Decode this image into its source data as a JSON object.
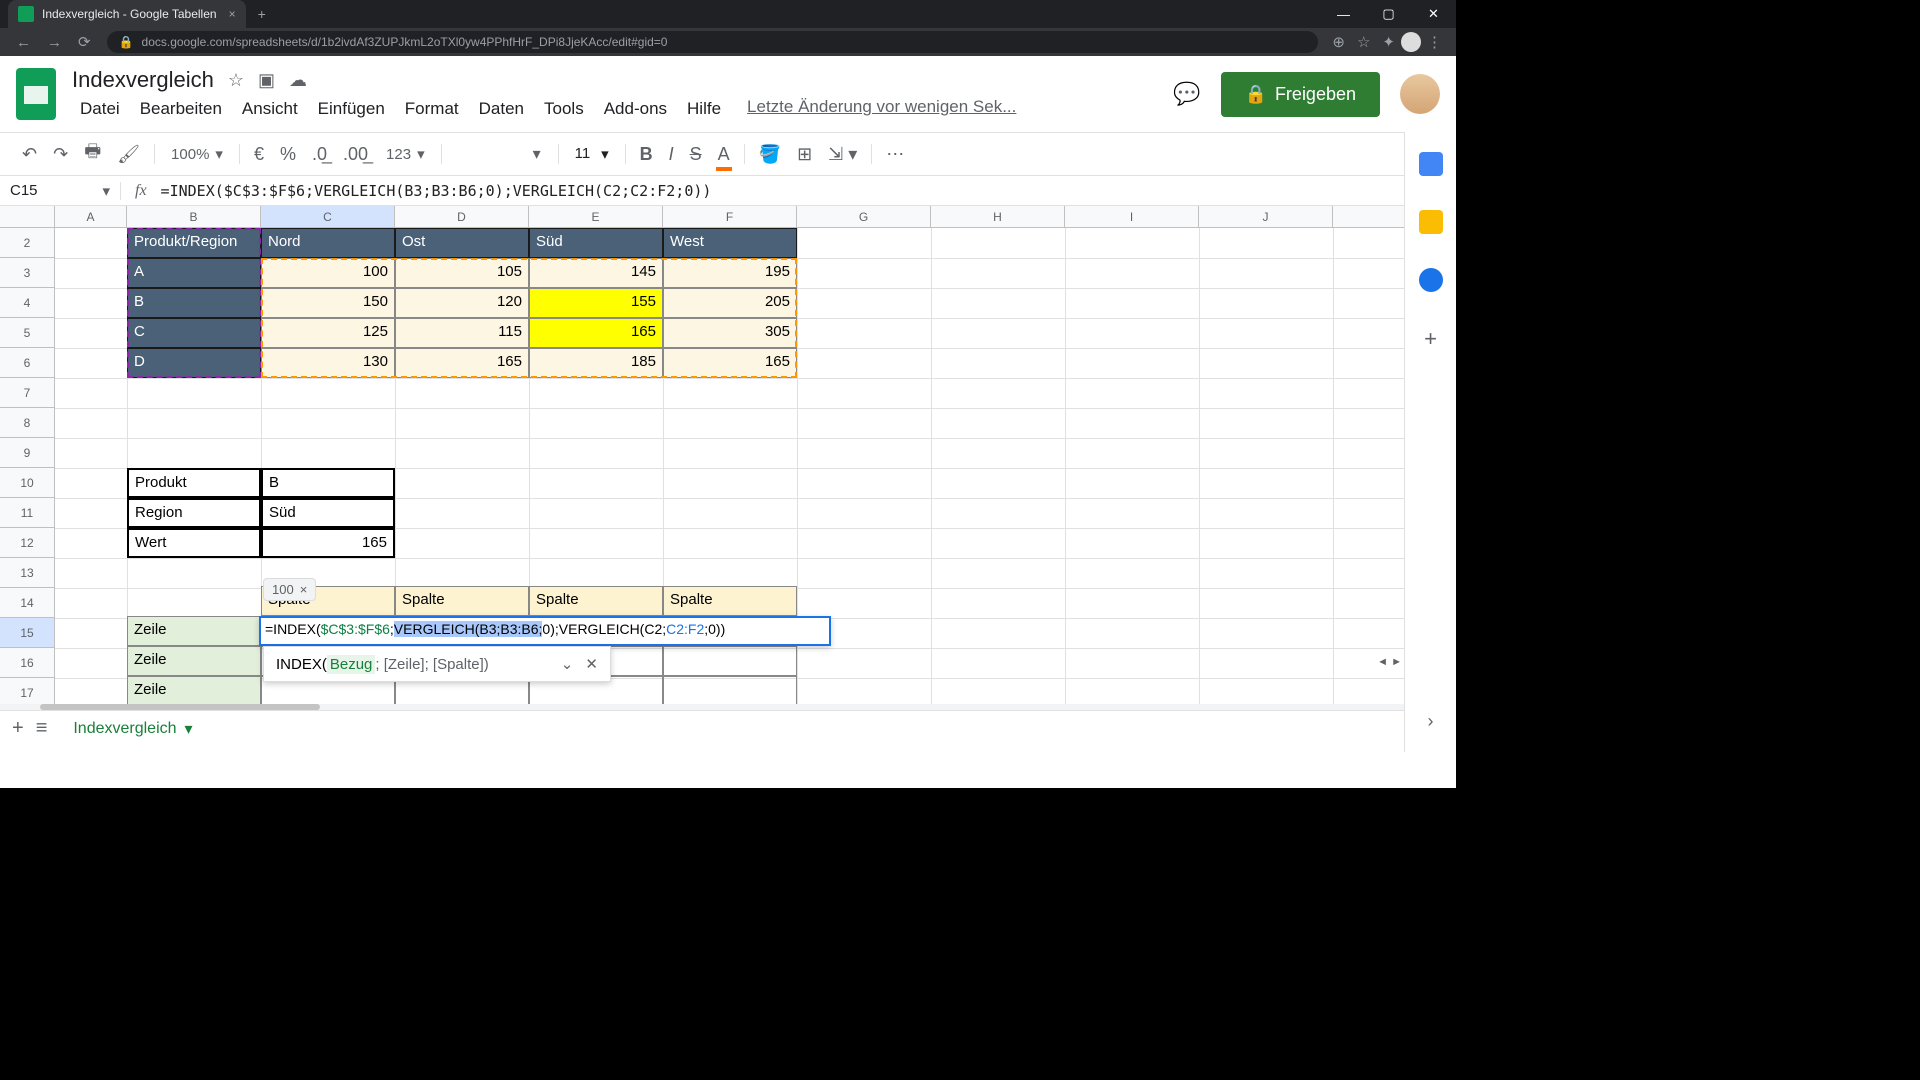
{
  "browser": {
    "tab_title": "Indexvergleich - Google Tabellen",
    "url": "docs.google.com/spreadsheets/d/1b2ivdAf3ZUPJkmL2oTXl0yw4PPhfHrF_DPi8JjeKAcc/edit#gid=0"
  },
  "doc": {
    "title": "Indexvergleich",
    "last_edit": "Letzte Änderung vor wenigen Sek...",
    "share": "Freigeben"
  },
  "menus": [
    "Datei",
    "Bearbeiten",
    "Ansicht",
    "Einfügen",
    "Format",
    "Daten",
    "Tools",
    "Add-ons",
    "Hilfe"
  ],
  "toolbar": {
    "zoom": "100%",
    "currency": "€",
    "percent": "%",
    "dec_less": ".0",
    "dec_more": ".00",
    "numfmt": "123",
    "font_size": "11"
  },
  "name_box": "C15",
  "formula_bar": "=INDEX($C$3:$F$6;VERGLEICH(B3;B3:B6;0);VERGLEICH(C2;C2:F2;0))",
  "columns": [
    "A",
    "B",
    "C",
    "D",
    "E",
    "F",
    "G",
    "H",
    "I",
    "J"
  ],
  "rows_visible": [
    2,
    3,
    4,
    5,
    6,
    7,
    8,
    9,
    10,
    11,
    12,
    13,
    14,
    15,
    16,
    17
  ],
  "table1": {
    "header_label": "Produkt/Region",
    "regions": [
      "Nord",
      "Ost",
      "Süd",
      "West"
    ],
    "products": [
      "A",
      "B",
      "C",
      "D"
    ],
    "values": [
      [
        100,
        105,
        145,
        195
      ],
      [
        150,
        120,
        155,
        205
      ],
      [
        125,
        115,
        165,
        305
      ],
      [
        130,
        165,
        185,
        165
      ]
    ],
    "highlight": [
      [
        1,
        2
      ],
      [
        2,
        2
      ]
    ]
  },
  "lookup": {
    "rows": [
      [
        "Produkt",
        "B"
      ],
      [
        "Region",
        "Süd"
      ],
      [
        "Wert",
        "165"
      ]
    ]
  },
  "index_tbl": {
    "spalte": "Spalte",
    "zeile": "Zeile"
  },
  "edit": {
    "preview": "100",
    "parts": {
      "p1": "=INDEX(",
      "p2": "$C$3:$F$6",
      "p3": ";",
      "sel": "VERGLEICH(B3;B3:B6;",
      "p4": "0)",
      "p5": ";VERGLEICH(C2;",
      "p6": "C2:F2",
      "p7": ";0))"
    },
    "helper": {
      "fn": "INDEX(",
      "arg1": "Bezug",
      "rest": "; [Zeile]; [Spalte])"
    }
  },
  "sheet_tab": "Indexvergleich"
}
